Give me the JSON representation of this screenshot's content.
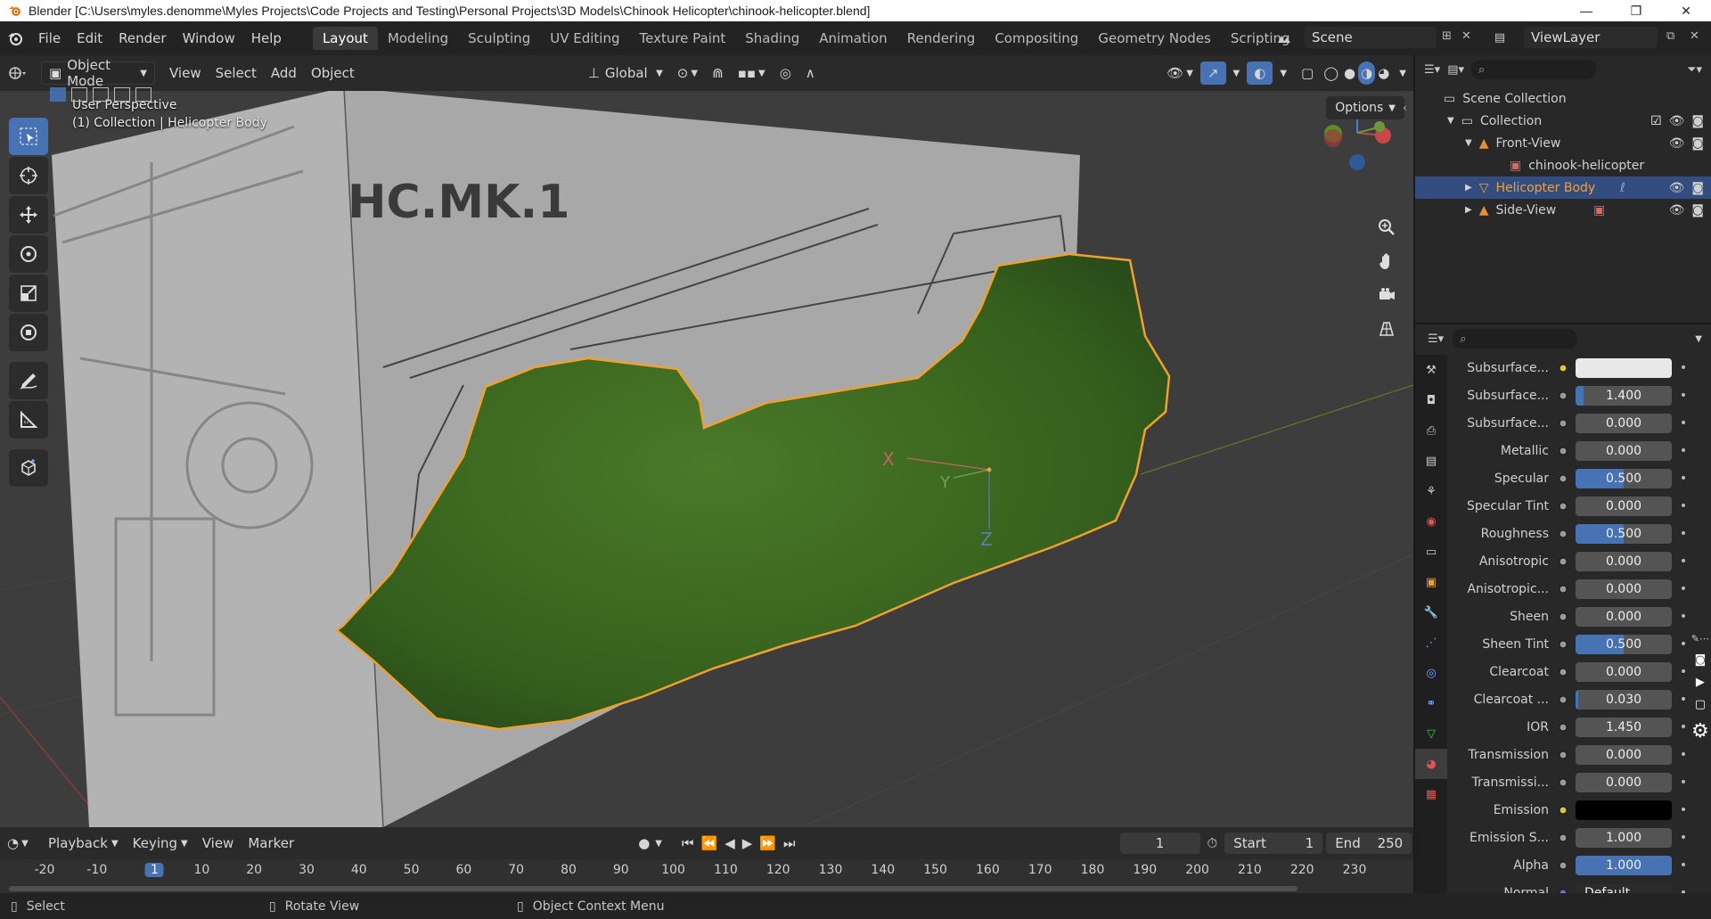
{
  "window": {
    "title": "Blender [C:\\Users\\myles.denomme\\Myles Projects\\Code Projects and Testing\\Personal Projects\\3D Models\\Chinook Helicopter\\chinook-helicopter.blend]",
    "minimize": "—",
    "maximize": "❐",
    "close": "✕"
  },
  "menubar": {
    "items": [
      "File",
      "Edit",
      "Render",
      "Window",
      "Help"
    ]
  },
  "workspaces": {
    "tabs": [
      "Layout",
      "Modeling",
      "Sculpting",
      "UV Editing",
      "Texture Paint",
      "Shading",
      "Animation",
      "Rendering",
      "Compositing",
      "Geometry Nodes",
      "Scripting"
    ],
    "active_index": 0,
    "add": "+"
  },
  "scene": {
    "name": "Scene"
  },
  "view_layer": {
    "name": "ViewLayer"
  },
  "viewport_header": {
    "mode": "Object Mode",
    "menus": [
      "View",
      "Select",
      "Add",
      "Object"
    ],
    "orientation": "Global",
    "options_label": "Options"
  },
  "viewport": {
    "perspective_label": "User Perspective",
    "collection_label": "(1) Collection | Helicopter Body",
    "blueprint_text": "HC.MK.1",
    "axis_labels": {
      "x": "X",
      "y": "Y",
      "z": "Z"
    },
    "body_color": "#3d6b1f",
    "selection_color": "#f0a030"
  },
  "outliner": {
    "search_placeholder": "",
    "rows": [
      {
        "label": "Scene Collection",
        "indent": 0
      },
      {
        "label": "Collection",
        "indent": 1
      },
      {
        "label": "Front-View",
        "indent": 2
      },
      {
        "label": "chinook-helicopter",
        "indent": 3
      },
      {
        "label": "Helicopter Body",
        "indent": 2,
        "selected": true
      },
      {
        "label": "Side-View",
        "indent": 2
      }
    ]
  },
  "properties": {
    "search_placeholder": "",
    "rows": [
      {
        "label": "Subsurface...",
        "value": "",
        "fill": 1.0,
        "color_swatch": "#e8e8e8",
        "dot": "yellow"
      },
      {
        "label": "Subsurface...",
        "value": "1.400",
        "fill": 0.08,
        "dot": "grey"
      },
      {
        "label": "Subsurface...",
        "value": "0.000",
        "fill": 0,
        "dot": "grey"
      },
      {
        "label": "Metallic",
        "value": "0.000",
        "fill": 0,
        "dot": "grey"
      },
      {
        "label": "Specular",
        "value": "0.500",
        "fill": 0.5,
        "dot": "grey"
      },
      {
        "label": "Specular Tint",
        "value": "0.000",
        "fill": 0,
        "dot": "grey"
      },
      {
        "label": "Roughness",
        "value": "0.500",
        "fill": 0.5,
        "dot": "grey"
      },
      {
        "label": "Anisotropic",
        "value": "0.000",
        "fill": 0,
        "dot": "grey"
      },
      {
        "label": "Anisotropic...",
        "value": "0.000",
        "fill": 0,
        "dot": "grey"
      },
      {
        "label": "Sheen",
        "value": "0.000",
        "fill": 0,
        "dot": "grey"
      },
      {
        "label": "Sheen Tint",
        "value": "0.500",
        "fill": 0.5,
        "dot": "grey"
      },
      {
        "label": "Clearcoat",
        "value": "0.000",
        "fill": 0,
        "dot": "grey"
      },
      {
        "label": "Clearcoat ...",
        "value": "0.030",
        "fill": 0.03,
        "dot": "grey"
      },
      {
        "label": "IOR",
        "value": "1.450",
        "fill": 0,
        "dot": "grey"
      },
      {
        "label": "Transmission",
        "value": "0.000",
        "fill": 0,
        "dot": "grey"
      },
      {
        "label": "Transmissi...",
        "value": "0.000",
        "fill": 0,
        "dot": "grey"
      },
      {
        "label": "Emission",
        "value": "",
        "fill": 1.0,
        "color_swatch": "#000000",
        "dot": "yellow"
      },
      {
        "label": "Emission S...",
        "value": "1.000",
        "fill": 0,
        "dot": "grey"
      },
      {
        "label": "Alpha",
        "value": "1.000",
        "fill": 1.0,
        "dot": "grey"
      },
      {
        "label": "Normal",
        "value": "Default",
        "fill": 0,
        "dot": "purple",
        "plain": true
      }
    ]
  },
  "timeline": {
    "menus": [
      "Playback",
      "Keying",
      "View",
      "Marker"
    ],
    "current_frame": "1",
    "start_label": "Start",
    "start": "1",
    "end_label": "End",
    "end": "250",
    "ruler": [
      "-20",
      "-10",
      "1",
      "10",
      "20",
      "30",
      "40",
      "50",
      "60",
      "70",
      "80",
      "90",
      "100",
      "110",
      "120",
      "130",
      "140",
      "150",
      "160",
      "170",
      "180",
      "190",
      "200",
      "210",
      "220",
      "230"
    ]
  },
  "statusbar": {
    "items": [
      "Select",
      "Rotate View",
      "Object Context Menu"
    ]
  }
}
